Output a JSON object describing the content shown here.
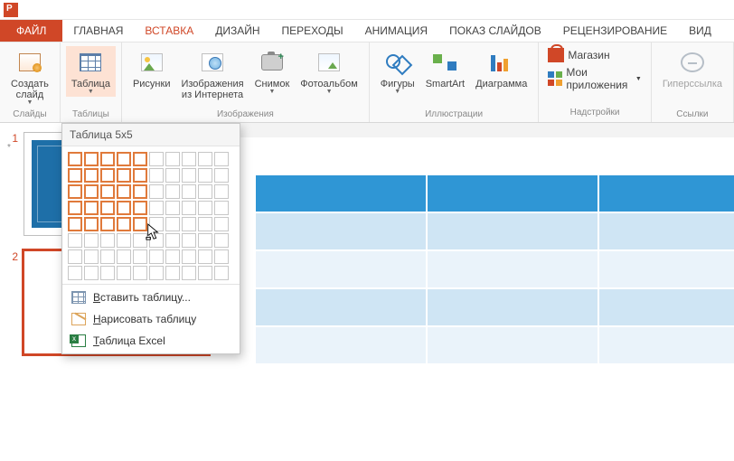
{
  "app": {
    "icon_label": "PowerPoint"
  },
  "tabs": {
    "file": "ФАЙЛ",
    "items": [
      "ГЛАВНАЯ",
      "ВСТАВКА",
      "ДИЗАЙН",
      "ПЕРЕХОДЫ",
      "АНИМАЦИЯ",
      "ПОКАЗ СЛАЙДОВ",
      "РЕЦЕНЗИРОВАНИЕ",
      "ВИД"
    ],
    "active_index": 1
  },
  "ribbon": {
    "groups": {
      "slides": {
        "name": "Слайды",
        "new_slide": "Создать\nслайд"
      },
      "tables": {
        "name": "Таблицы",
        "table": "Таблица"
      },
      "images": {
        "name": "Изображения",
        "pictures": "Рисунки",
        "online": "Изображения\nиз Интернета",
        "screenshot": "Снимок",
        "album": "Фотоальбом"
      },
      "illus": {
        "name": "Иллюстрации",
        "shapes": "Фигуры",
        "smartart": "SmartArt",
        "chart": "Диаграмма"
      },
      "addins": {
        "name": "Надстройки",
        "store": "Магазин",
        "myapps": "Мои приложения"
      },
      "links": {
        "name": "Ссылки",
        "hyperlink": "Гиперссылка"
      }
    }
  },
  "picker": {
    "title": "Таблица 5x5",
    "rows": 5,
    "cols": 5,
    "total_rows": 8,
    "total_cols": 10,
    "menu": {
      "insert": {
        "full": "Вставить таблицу...",
        "u": "В",
        "rest": "ставить таблицу..."
      },
      "draw": {
        "full": "Нарисовать таблицу",
        "u": "Н",
        "rest": "арисовать таблицу"
      },
      "excel": {
        "full": "Таблица Excel",
        "u": "Т",
        "rest": "аблица Excel"
      }
    }
  },
  "thumbs": {
    "slide1_num": "1",
    "slide1_star": "*",
    "slide2_num": "2"
  },
  "preview_table": {
    "cols": 3,
    "rows": 5
  }
}
